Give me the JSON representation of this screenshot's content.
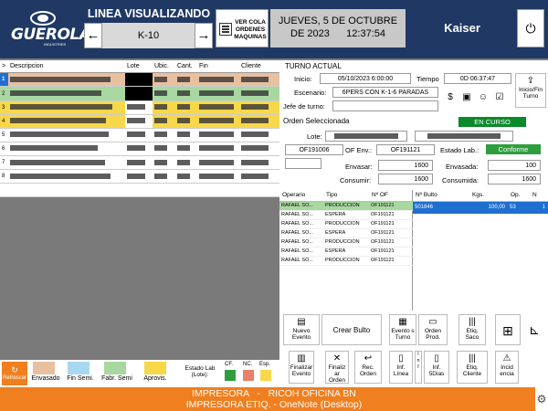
{
  "header": {
    "logo_text": "GUEROLA",
    "logo_sub": "INDUSTRIES",
    "line_title": "LINEA VISUALIZANDO",
    "line_code": "K-10",
    "prev_icon": "←",
    "next_icon": "→",
    "orders_button_label": "VER COLA ORDENES MAQUINAS",
    "date_line1": "JUEVES, 5 DE OCTUBRE",
    "date_line2": "DE 2023      12:37:54",
    "user": "Kaiser",
    "power_icon": "⏻"
  },
  "orders_table": {
    "headers": [
      ">",
      "Descripcion",
      "Lote",
      "Ubic.",
      "Cant.",
      "Fin",
      "Cliente"
    ],
    "row_numbers": [
      "1",
      "2",
      "3",
      "4",
      "5",
      "6",
      "7",
      "8"
    ]
  },
  "turno": {
    "title": "TURNO ACTUAL",
    "inicio_label": "Inicio:",
    "inicio_value": "05/10/2023 6:00:00",
    "tiempo_label": "Tiempo",
    "tiempo_value": "0D 06:37:47",
    "escenario_label": "Escenario:",
    "escenario_value": "6PERS CON  K-1-6 PARADAS",
    "jefe_label": "Jefe de turno:",
    "jefe_value": "",
    "inicio_fin_turno_label": "Inicio/Fin Turno",
    "orden_sel_title": "Orden Seleccionada",
    "en_curso": "EN CURSO",
    "lote_label": "Lote:",
    "of_value": "OF191006",
    "of_env_label": "OF Env.:",
    "of_env_value": "OF191121",
    "estado_lab_label": "Estado Lab.:",
    "estado_lab_value": "Conforme",
    "envasar_label": "Envasar:",
    "envasar_value": "1600",
    "envasada_label": "Envasada:",
    "envasada_value": "100",
    "consumir_label": "Consumir:",
    "consumir_value": "1600",
    "consumida_label": "Consumida:",
    "consumida_value": "1600"
  },
  "operations": {
    "headers": [
      "Operario",
      "Tipo",
      "Nº OF"
    ],
    "rows": [
      {
        "op": "RAFAEL SO...",
        "tipo": "PRODUCCION",
        "of": "OF191121"
      },
      {
        "op": "RAFAEL SO...",
        "tipo": "ESPERA",
        "of": "OF191121"
      },
      {
        "op": "RAFAEL SO...",
        "tipo": "PRODUCCION",
        "of": "OF191121"
      },
      {
        "op": "RAFAEL SO...",
        "tipo": "ESPERA",
        "of": "OF191121"
      },
      {
        "op": "RAFAEL SO...",
        "tipo": "PRODUCCION",
        "of": "OF191121"
      },
      {
        "op": "RAFAEL SO...",
        "tipo": "ESPERA",
        "of": "OF191121"
      },
      {
        "op": "RAFAEL SO...",
        "tipo": "PRODUCCION",
        "of": "OF191121"
      }
    ]
  },
  "bultos": {
    "headers": [
      "Nº Bulto",
      "Kgs.",
      "Op.",
      "N"
    ],
    "rows": [
      {
        "bulto": "501846",
        "kgs": "100,00",
        "op": "53",
        "n": "1"
      }
    ]
  },
  "actions": {
    "nuevo_evento": "Nuevo Evento",
    "crear_bulto": "Crear Bulto",
    "eventos_turno": "Evento s Turno",
    "orden_prod": "Orden Prod.",
    "etiq_saco": "Etiq. Saco",
    "finalizar_evento": "Finalizar Evento",
    "finalizar_orden": "Finaliz ar Orden",
    "rec_orden": "Rec. Orden",
    "inf_linea": "Inf. Línea",
    "inf_5dias": "Inf. 5Dias",
    "etiq_cliente": "Etiq. Cliente",
    "incidencia": "Incid encia"
  },
  "legend": {
    "refresh": "Refrescar",
    "items": [
      "Envasado",
      "Fin Semi.",
      "Fabr. Semi",
      "Aprovis."
    ],
    "colors": [
      "#e8c0a0",
      "#a8d8f0",
      "#a8d8a0",
      "#f7d84a"
    ],
    "estado_lab": "Estado Lab (Lote):",
    "estado_codes": [
      "CF.",
      "NC.",
      "Esp."
    ],
    "estado_colors": [
      "#2e9e3e",
      "#e8806a",
      "#f7d84a"
    ]
  },
  "footer": {
    "line1": "IMPRESORA   -   RICOH OFICINA BN",
    "line2": "IMPRESORA ETIQ. - OneNote (Desktop)"
  }
}
